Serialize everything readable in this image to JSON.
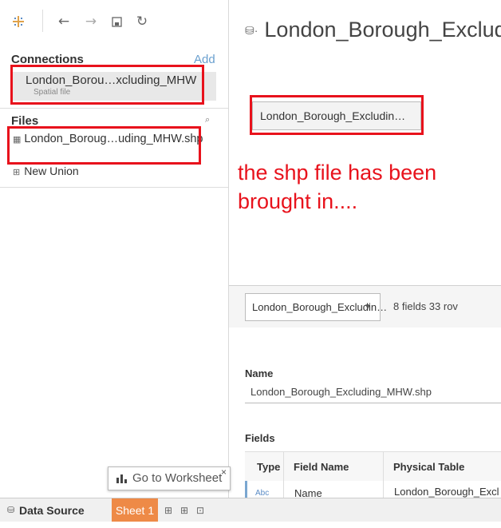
{
  "toolbar": {
    "logo_icon": "tableau-logo-icon",
    "back_glyph": "←",
    "forward_glyph": "→",
    "save_glyph": "▭",
    "refresh_glyph": "↻"
  },
  "connections": {
    "heading": "Connections",
    "add_label": "Add",
    "item_name": "London_Borou…xcluding_MHW",
    "item_type": "Spatial file"
  },
  "files": {
    "heading": "Files",
    "file_name": "London_Boroug…uding_MHW.shp",
    "union_label": "New Union"
  },
  "main": {
    "title": "London_Borough_Exclud",
    "canvas_table": "London_Borough_Excludin…",
    "annotation_line1": "the shp file has been",
    "annotation_line2": "brought in....",
    "table_select": "London_Borough_Excludin…",
    "fields_rows": "8 fields 33 rov",
    "name_label": "Name",
    "name_value": "London_Borough_Excluding_MHW.shp",
    "fields_label": "Fields",
    "columns": [
      "Type",
      "Field Name",
      "Physical Table"
    ],
    "row": {
      "type": "Abc",
      "field_name": "Name",
      "physical_table": "London_Borough_Excl"
    }
  },
  "tooltip": {
    "label": "Go to Worksheet",
    "close": "×"
  },
  "bottom": {
    "data_source_label": "Data Source",
    "sheet_label": "Sheet 1"
  },
  "colors": {
    "highlight": "#e8121c",
    "sheet_tab": "#ee8a47",
    "accent": "#7aa7d0"
  }
}
